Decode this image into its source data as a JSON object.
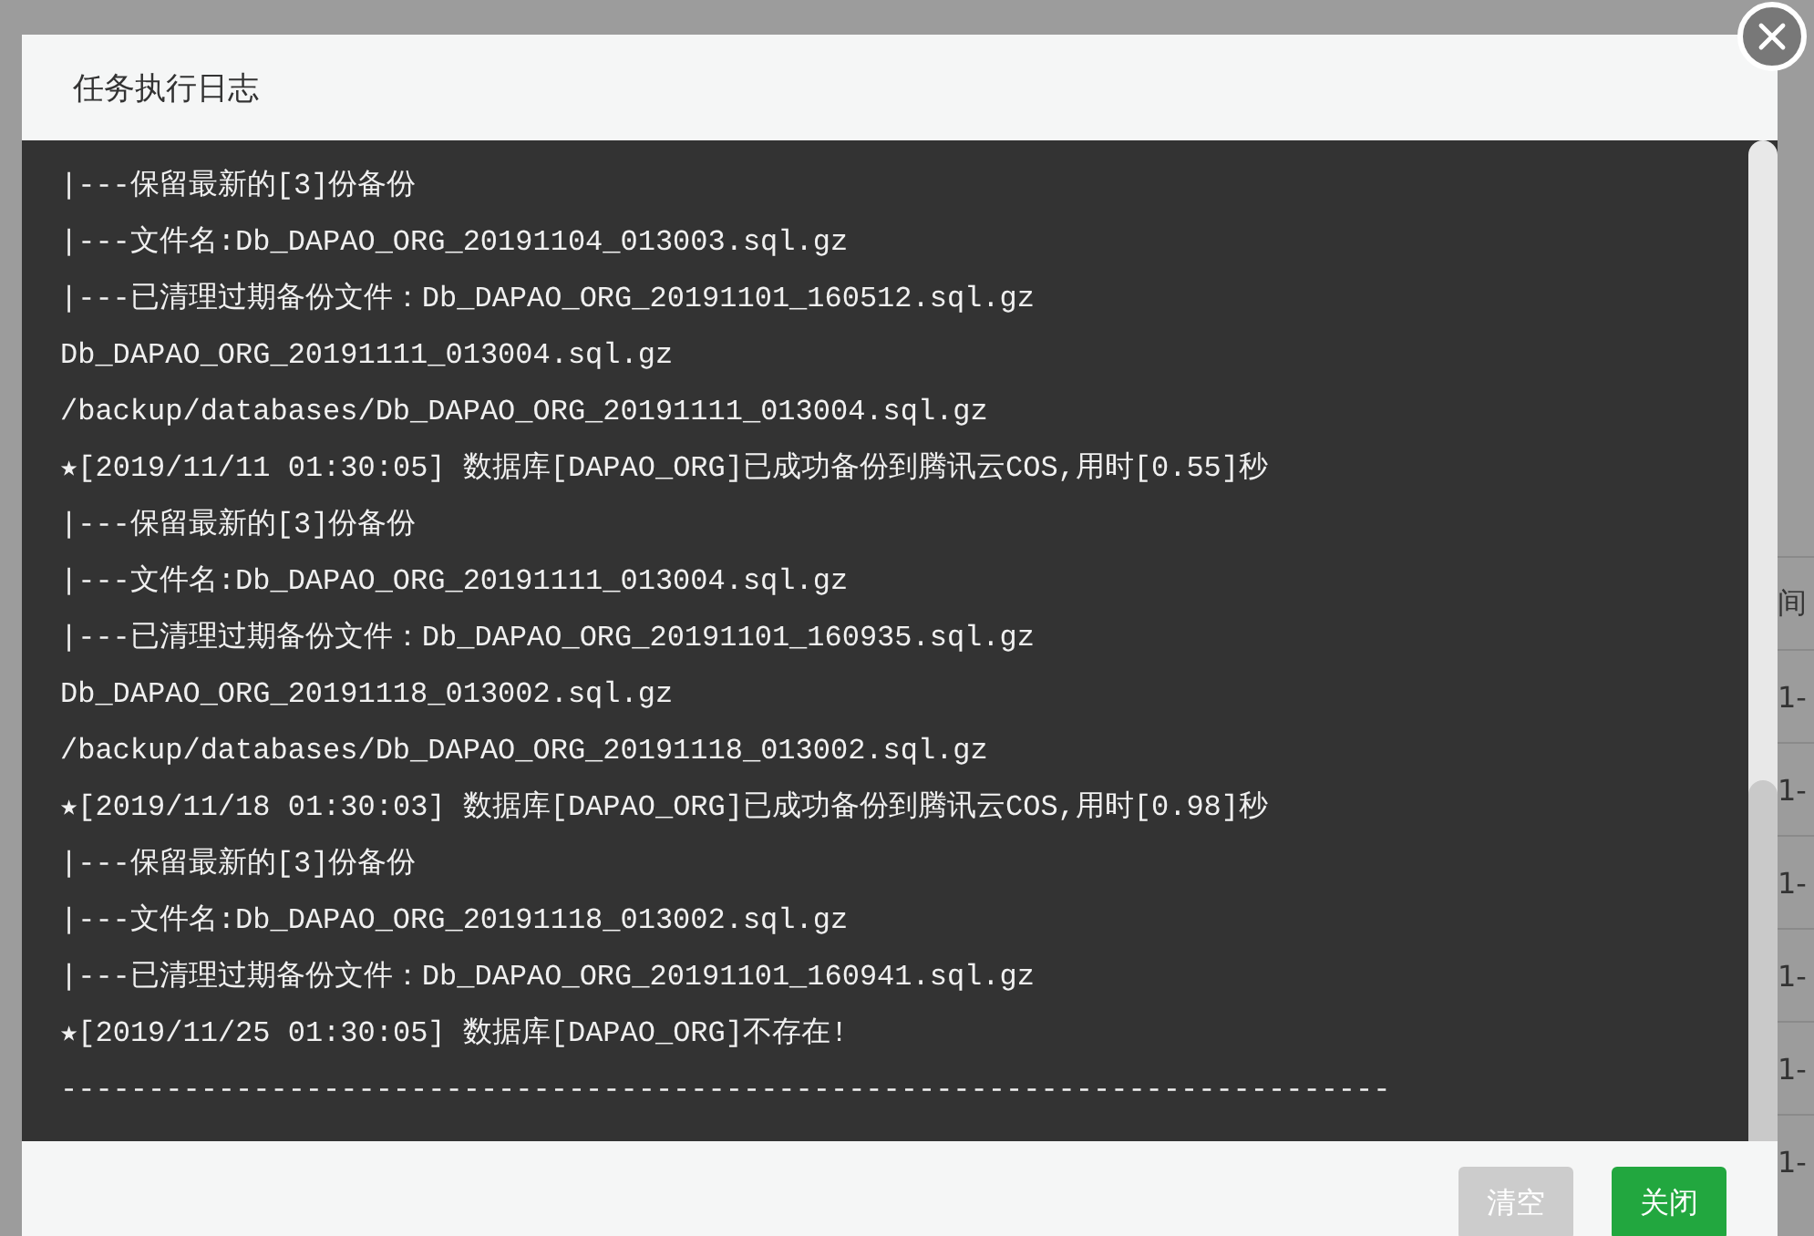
{
  "background": {
    "column_fragments": [
      "间",
      "1-",
      "1-",
      "1-",
      "1-",
      "1-",
      "1-"
    ]
  },
  "dialog": {
    "title": "任务执行日志",
    "log_lines": [
      "|---保留最新的[3]份备份",
      "|---文件名:Db_DAPAO_ORG_20191104_013003.sql.gz",
      "|---已清理过期备份文件：Db_DAPAO_ORG_20191101_160512.sql.gz",
      "Db_DAPAO_ORG_20191111_013004.sql.gz",
      "/backup/databases/Db_DAPAO_ORG_20191111_013004.sql.gz",
      "★[2019/11/11 01:30:05] 数据库[DAPAO_ORG]已成功备份到腾讯云COS,用时[0.55]秒",
      "|---保留最新的[3]份备份",
      "|---文件名:Db_DAPAO_ORG_20191111_013004.sql.gz",
      "|---已清理过期备份文件：Db_DAPAO_ORG_20191101_160935.sql.gz",
      "Db_DAPAO_ORG_20191118_013002.sql.gz",
      "/backup/databases/Db_DAPAO_ORG_20191118_013002.sql.gz",
      "★[2019/11/18 01:30:03] 数据库[DAPAO_ORG]已成功备份到腾讯云COS,用时[0.98]秒",
      "|---保留最新的[3]份备份",
      "|---文件名:Db_DAPAO_ORG_20191118_013002.sql.gz",
      "|---已清理过期备份文件：Db_DAPAO_ORG_20191101_160941.sql.gz",
      "★[2019/11/25 01:30:05] 数据库[DAPAO_ORG]不存在!",
      "----------------------------------------------------------------------------"
    ],
    "buttons": [
      {
        "label": "清空",
        "kind": "secondary"
      },
      {
        "label": "关闭",
        "kind": "primary"
      }
    ]
  }
}
